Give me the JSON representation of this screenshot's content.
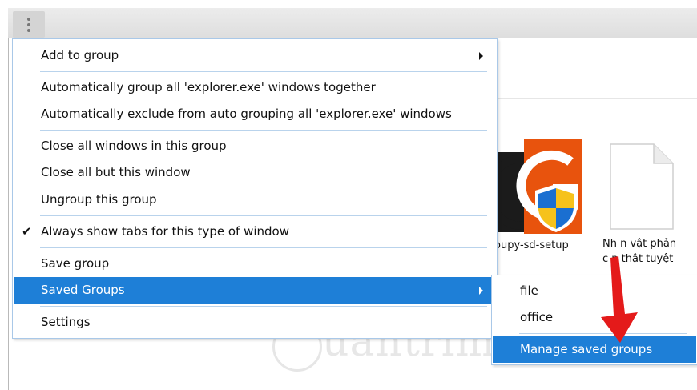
{
  "menu": {
    "items": [
      {
        "label": "Add to group",
        "has_submenu": true
      },
      {
        "label": "Automatically group all 'explorer.exe' windows together"
      },
      {
        "label": "Automatically exclude from auto grouping all 'explorer.exe' windows"
      },
      {
        "label": "Close all windows in this group"
      },
      {
        "label": "Close all but this window"
      },
      {
        "label": "Ungroup this group"
      },
      {
        "label": "Always show tabs for this type of window",
        "checked": true
      },
      {
        "label": "Save group"
      },
      {
        "label": "Saved Groups",
        "has_submenu": true,
        "selected": true
      },
      {
        "label": "Settings"
      }
    ],
    "check_mark": "✔"
  },
  "submenu": {
    "items": [
      {
        "label": "file"
      },
      {
        "label": "office"
      },
      {
        "label": "Manage saved groups",
        "selected": true
      }
    ]
  },
  "files": {
    "groupy_label": "roupy-sd-setup",
    "doc_label_1": "Nh  n vật phản",
    "doc_label_2": "c  n thật tuyệt"
  },
  "watermark": {
    "text": "uantrimang"
  },
  "colors": {
    "selection": "#1e7fd7",
    "menu_border": "#a9c8e8",
    "arrow": "#e41a1a",
    "groupy_orange": "#e8530d"
  },
  "icons": [
    "kebab-menu-icon",
    "submenu-arrow-icon",
    "checkmark-icon",
    "groupy-app-icon",
    "shield-icon",
    "document-icon",
    "red-arrow-annotation-icon"
  ]
}
